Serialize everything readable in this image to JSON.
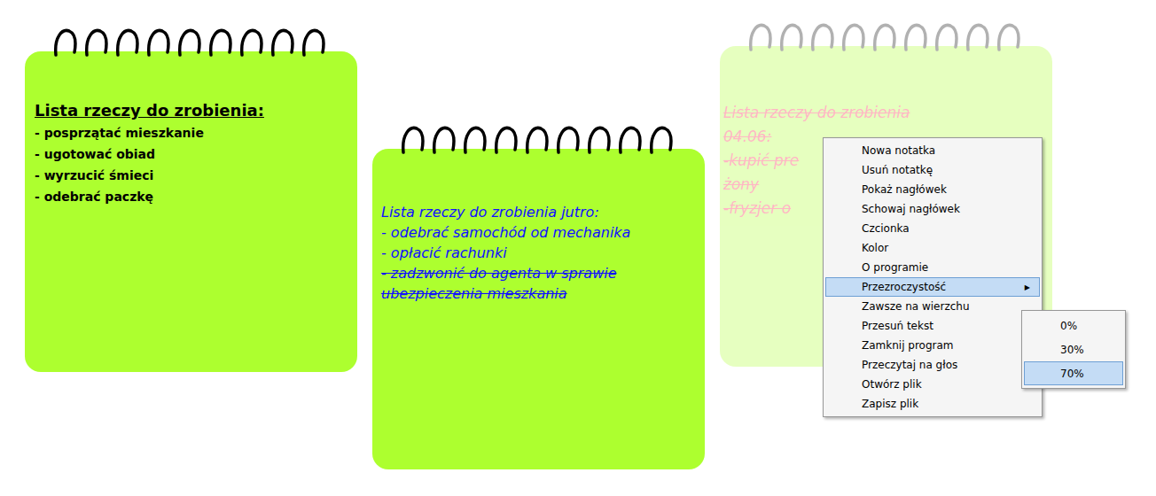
{
  "notes": [
    {
      "kind": "bold",
      "color": "#000000",
      "opacity": 1,
      "lines": [
        {
          "text": "Lista rzeczy do zrobienia:",
          "heading": true,
          "strike": false
        },
        {
          "text": "- posprzątać mieszkanie",
          "heading": false,
          "strike": false
        },
        {
          "text": "- ugotować obiad",
          "heading": false,
          "strike": false
        },
        {
          "text": "- wyrzucić śmieci",
          "heading": false,
          "strike": false
        },
        {
          "text": "- odebrać paczkę",
          "heading": false,
          "strike": false
        }
      ]
    },
    {
      "kind": "script",
      "color": "#1010ff",
      "opacity": 1,
      "lines": [
        {
          "text": "Lista rzeczy do zrobienia jutro:",
          "heading": false,
          "strike": false
        },
        {
          "text": "- odebrać samochód od mechanika",
          "heading": false,
          "strike": false
        },
        {
          "text": "- opłacić rachunki",
          "heading": false,
          "strike": false
        },
        {
          "text": "- zadzwonić do agenta w sprawie",
          "heading": false,
          "strike": true
        },
        {
          "text": "ubezpieczenia mieszkania",
          "heading": false,
          "strike": true
        }
      ]
    },
    {
      "kind": "script",
      "color": "#ff1040",
      "opacity": 0.3,
      "lines": [
        {
          "text": "Lista rzeczy do zrobienia",
          "heading": false,
          "strike": true
        },
        {
          "text": "04.06:",
          "heading": false,
          "strike": true
        },
        {
          "text": "-kupić pre",
          "heading": false,
          "strike": true
        },
        {
          "text": "żony",
          "heading": false,
          "strike": true
        },
        {
          "text": "-fryzjer o",
          "heading": false,
          "strike": true
        }
      ]
    }
  ],
  "context_menu": {
    "items": [
      {
        "label": "Nowa notatka",
        "selected": false,
        "arrow": ""
      },
      {
        "label": "Usuń notatkę",
        "selected": false,
        "arrow": ""
      },
      {
        "label": "Pokaż nagłówek",
        "selected": false,
        "arrow": ""
      },
      {
        "label": "Schowaj nagłówek",
        "selected": false,
        "arrow": ""
      },
      {
        "label": "Czcionka",
        "selected": false,
        "arrow": ""
      },
      {
        "label": "Kolor",
        "selected": false,
        "arrow": ""
      },
      {
        "label": "O programie",
        "selected": false,
        "arrow": ""
      },
      {
        "label": "Przezroczystość",
        "selected": true,
        "arrow": "▶"
      },
      {
        "label": "Zawsze na wierzchu",
        "selected": false,
        "arrow": ""
      },
      {
        "label": "Przesuń tekst",
        "selected": false,
        "arrow": "▶"
      },
      {
        "label": "Zamknij program",
        "selected": false,
        "arrow": ""
      },
      {
        "label": "Przeczytaj na głos",
        "selected": false,
        "arrow": ""
      },
      {
        "label": "Otwórz plik",
        "selected": false,
        "arrow": ""
      },
      {
        "label": "Zapisz plik",
        "selected": false,
        "arrow": ""
      }
    ]
  },
  "submenu": {
    "items": [
      {
        "label": "0%",
        "selected": false
      },
      {
        "label": "30%",
        "selected": false
      },
      {
        "label": "70%",
        "selected": true
      }
    ]
  }
}
